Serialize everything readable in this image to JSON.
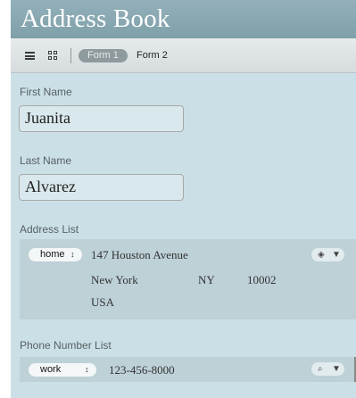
{
  "window": {
    "title": "Address Book"
  },
  "toolbar": {
    "list_view_icon": "list-view-icon",
    "table_view_icon": "table-view-icon",
    "form1_label": "Form 1",
    "form2_label": "Form 2"
  },
  "fields": {
    "first_name": {
      "label": "First Name",
      "value": "Juanita"
    },
    "last_name": {
      "label": "Last Name",
      "value": "Alvarez"
    }
  },
  "address_list": {
    "label": "Address List",
    "items": [
      {
        "type": "home",
        "street": "147 Houston Avenue",
        "city": "New York",
        "state": "NY",
        "zip": "10002",
        "country": "USA"
      }
    ]
  },
  "phone_list": {
    "label": "Phone Number List",
    "items": [
      {
        "type": "work",
        "number": "123-456-8000"
      }
    ]
  },
  "colors": {
    "header": "#7fa0aa",
    "content_bg": "#cbe0e6",
    "list_bg": "#bdd1d7"
  }
}
